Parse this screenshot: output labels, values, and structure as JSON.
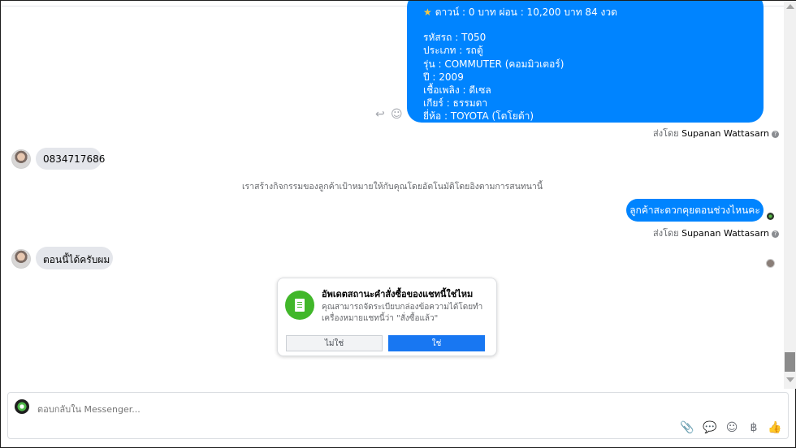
{
  "thread": {
    "sent_message_lines": [
      "ดาวน์ : 0 บาท ผ่อน : 10,200 บาท 84 งวด",
      "",
      "รหัสรถ : T050",
      "ประเภท : รถตู้",
      "รุ่น : COMMUTER (คอมมิวเตอร์)",
      "ปี : 2009",
      "เชื้อเพลิง : ดีเซล",
      "เกียร์ : ธรรมดา",
      "ยี่ห้อ : TOYOTA (โตโยต้า)"
    ],
    "sent_by_label": "ส่งโดย",
    "sender_name": "Supanan Wattasarn",
    "incoming_phone": "0834717686",
    "system_note": "เราสร้างกิจกรรมของลูกค้าเป้าหมายให้กับคุณโดยอัตโนมัติโดยอิงตามการสนทนานี้",
    "outgoing_question": "ลูกค้าสะดวกคุยตอนช่วงไหนคะ",
    "incoming_reply": "ตอนนี้ได้ครับผม"
  },
  "order_prompt": {
    "title": "อัพเดตสถานะคำสั่งซื้อของแชทนี้ใช่ไหม",
    "body": "คุณสามารถจัดระเบียบกล่องข้อความได้โดยทำเครื่องหมายแชทนี้ว่า \"สั่งซื้อแล้ว\"",
    "no_label": "ไม่ใช่",
    "yes_label": "ใช่"
  },
  "composer": {
    "placeholder": "ตอบกลับใน Messenger...",
    "currency_symbol": "฿"
  },
  "icons": {
    "reply": "reply-icon",
    "emoji": "smile-icon",
    "attachment": "paperclip-icon",
    "saved_reply": "chat-bubble-icon",
    "emoji_picker": "smile-icon",
    "like": "thumbs-up-icon"
  },
  "colors": {
    "messenger_blue": "#0084ff",
    "facebook_blue": "#1877f2",
    "incoming_gray": "#e4e6eb",
    "order_green": "#41b72a"
  }
}
